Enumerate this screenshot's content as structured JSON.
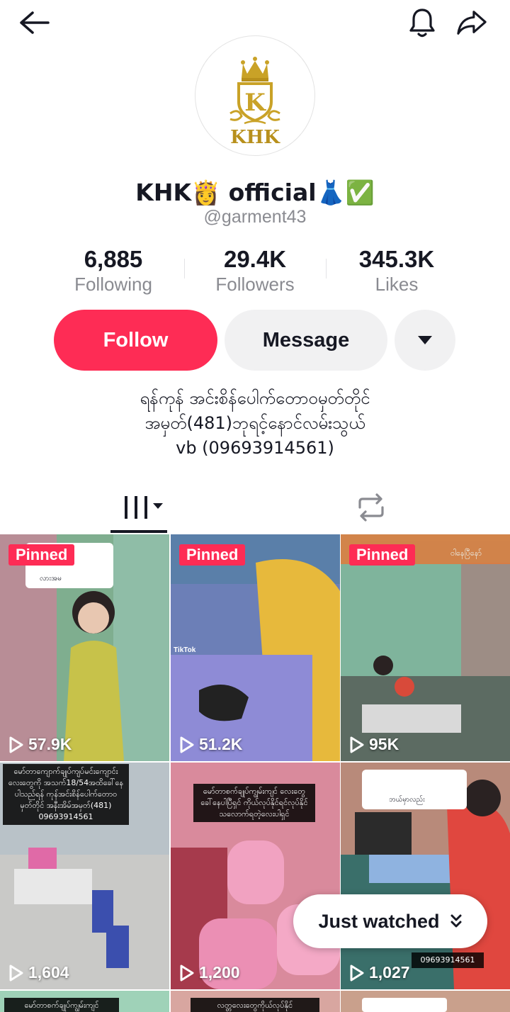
{
  "profile": {
    "name": "KHK👸 official👗✅",
    "handle": "@garment43",
    "avatar_text": "KHK",
    "avatar_letter": "K"
  },
  "stats": [
    {
      "value": "6,885",
      "label": "Following"
    },
    {
      "value": "29.4K",
      "label": "Followers"
    },
    {
      "value": "345.3K",
      "label": "Likes"
    }
  ],
  "buttons": {
    "follow": "Follow",
    "message": "Message"
  },
  "bio": [
    "ရန်ကုန် အင်းစိန်ပေါက်တောဝမှတ်တိုင်",
    "အမှတ်(481)ဘုရင့်နောင်လမ်းသွယ်",
    "vb (09693914561)"
  ],
  "videos": [
    {
      "views": "57.9K",
      "pinned": "Pinned",
      "bg": "#7fae8f",
      "accent": "#c7c24a"
    },
    {
      "views": "51.2K",
      "pinned": "Pinned",
      "bg": "#6c7fb7",
      "accent": "#e7b93c"
    },
    {
      "views": "95K",
      "pinned": "Pinned",
      "bg": "#7fb49c",
      "accent": "#5c6b62"
    },
    {
      "views": "1,604",
      "pinned": "",
      "bg": "#b9c2c8",
      "accent": "#3b4fae"
    },
    {
      "views": "1,200",
      "pinned": "",
      "bg": "#d98a9c",
      "accent": "#f1a2c1"
    },
    {
      "views": "1,027",
      "pinned": "",
      "bg": "#b88a7a",
      "accent": "#e0473f"
    }
  ],
  "captions": {
    "video1_comment": "လားအမ",
    "video2_tag": "TikTok",
    "video3_top": "ဝါနေပြီနော်",
    "video4": "မော်တာကျောက်ချုပ်ကျပ်မင်းကျောင်းလေးတွေကို အသက်18/54အထိခေါ်နေပါသည်ရန် ကုန်အင်းစိန်ပေါက်တောဝမှတ်တိုင် အနီးအိမ်အမှတ်(481) 09693914561",
    "video5": "မော်တာစက်ချုပ်ကျွမ်းကျင် လေးတွေခေါ်နေပါပြီရှင် ကိုယ်လုပ်နိုင်ရင်လုပ်နိုင် သလောက်ရတဲ့လေးပါရှင်",
    "video6_reply": "ဘယ်မှာလည်း",
    "video6_phone": "09693914561",
    "row3_left": "မော်တာစက်ချုပ်ကျွမ်းကျင်",
    "row3_mid": "လတ္တလေးတွေကိုယ်လုပ်နိုင်"
  },
  "just_watched": "Just watched"
}
